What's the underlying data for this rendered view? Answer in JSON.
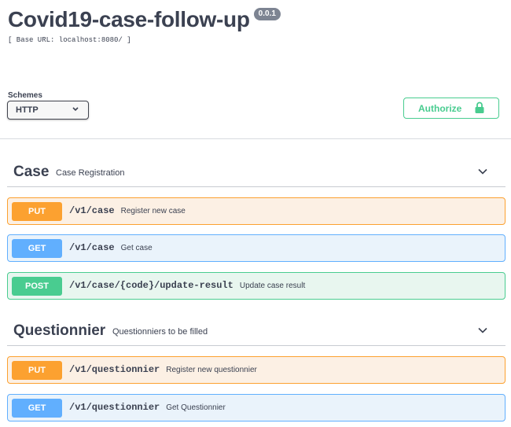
{
  "info": {
    "title": "Covid19-case-follow-up",
    "version": "0.0.1",
    "base_url": "[ Base URL: localhost:8080/ ]"
  },
  "schemes": {
    "label": "Schemes",
    "selected": "HTTP"
  },
  "authorize": {
    "label": "Authorize"
  },
  "tags": [
    {
      "name": "Case",
      "description": "Case Registration",
      "operations": [
        {
          "method": "PUT",
          "path": "/v1/case",
          "summary": "Register new case"
        },
        {
          "method": "GET",
          "path": "/v1/case",
          "summary": "Get case"
        },
        {
          "method": "POST",
          "path": "/v1/case/{code}/update-result",
          "summary": "Update case result"
        }
      ]
    },
    {
      "name": "Questionnier",
      "description": "Questionniers to be filled",
      "operations": [
        {
          "method": "PUT",
          "path": "/v1/questionnier",
          "summary": "Register new questionnier"
        },
        {
          "method": "GET",
          "path": "/v1/questionnier",
          "summary": "Get Questionnier"
        }
      ]
    }
  ],
  "colors": {
    "put": "#fca130",
    "get": "#61affe",
    "post": "#49cc90",
    "authorize": "#49cc90",
    "text": "#3b4151"
  },
  "icons": {
    "schemes_dropdown": "chevron-down-icon",
    "authorize": "lock-icon",
    "tag_toggle": "chevron-down-icon"
  }
}
